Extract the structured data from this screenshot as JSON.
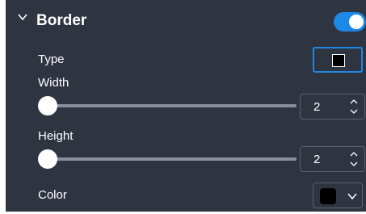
{
  "section": {
    "title": "Border",
    "enabled": true
  },
  "type": {
    "label": "Type",
    "style": "solid"
  },
  "width": {
    "label": "Width",
    "value": "2"
  },
  "height": {
    "label": "Height",
    "value": "2"
  },
  "color": {
    "label": "Color",
    "value": "#000000"
  },
  "icons": {
    "collapse": "chevron-down-icon",
    "border_type": "square-icon",
    "stepper": "up-down-arrows-icon",
    "dropdown": "chevron-down-icon"
  },
  "colors": {
    "panel_background": "#2f3441",
    "accent": "#1e88e5",
    "text": "#ffffff",
    "slider_track": "#8a8f99"
  }
}
